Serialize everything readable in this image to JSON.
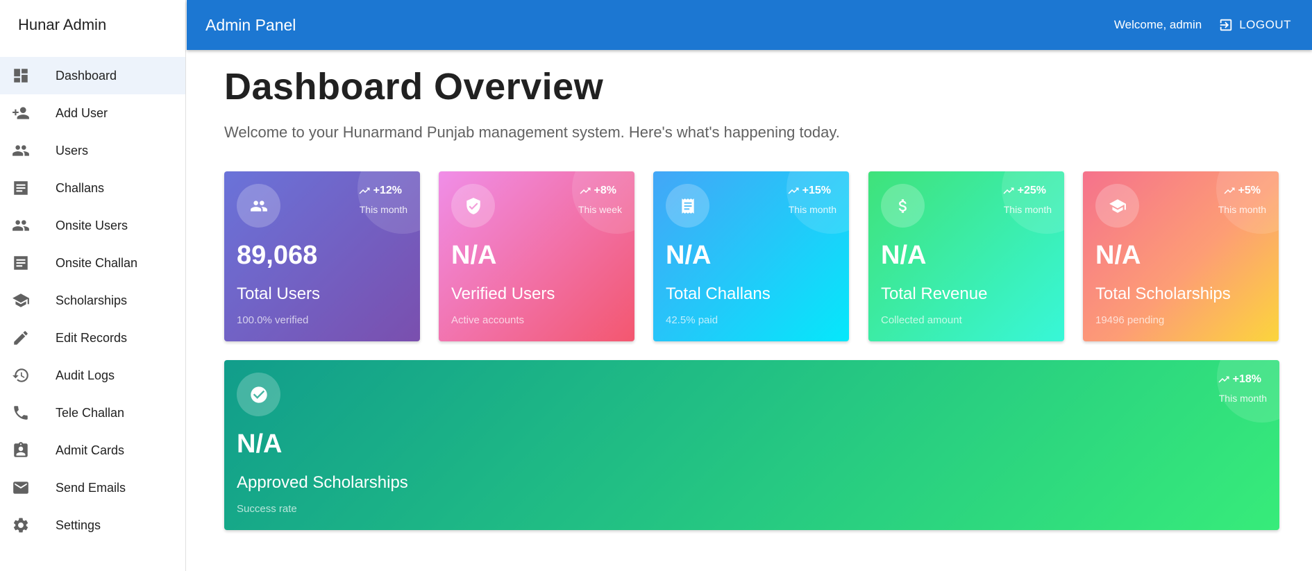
{
  "sidebar": {
    "brand": "Hunar Admin",
    "items": [
      {
        "label": "Dashboard",
        "icon": "dashboard-icon"
      },
      {
        "label": "Add User",
        "icon": "person-add-icon"
      },
      {
        "label": "Users",
        "icon": "people-icon"
      },
      {
        "label": "Challans",
        "icon": "receipt-icon"
      },
      {
        "label": "Onsite Users",
        "icon": "people-icon"
      },
      {
        "label": "Onsite Challan",
        "icon": "receipt-icon"
      },
      {
        "label": "Scholarships",
        "icon": "school-icon"
      },
      {
        "label": "Edit Records",
        "icon": "edit-icon"
      },
      {
        "label": "Audit Logs",
        "icon": "history-icon"
      },
      {
        "label": "Tele Challan",
        "icon": "phone-icon"
      },
      {
        "label": "Admit Cards",
        "icon": "badge-icon"
      },
      {
        "label": "Send Emails",
        "icon": "email-icon"
      },
      {
        "label": "Settings",
        "icon": "gear-icon"
      }
    ]
  },
  "appbar": {
    "title": "Admin Panel",
    "welcome": "Welcome, admin",
    "logout_label": "LOGOUT",
    "color": "#1c77d2"
  },
  "main": {
    "title": "Dashboard Overview",
    "subtitle": "Welcome to your Hunarmand Punjab management system. Here's what's happening today."
  },
  "cards": [
    {
      "value": "89,068",
      "label": "Total Users",
      "sub": "100.0% verified",
      "trend": "+12%",
      "period": "This month",
      "icon": "people-icon"
    },
    {
      "value": "N/A",
      "label": "Verified Users",
      "sub": "Active accounts",
      "trend": "+8%",
      "period": "This week",
      "icon": "verified-shield-icon"
    },
    {
      "value": "N/A",
      "label": "Total Challans",
      "sub": "42.5% paid",
      "trend": "+15%",
      "period": "This month",
      "icon": "receipt-icon"
    },
    {
      "value": "N/A",
      "label": "Total Revenue",
      "sub": "Collected amount",
      "trend": "+25%",
      "period": "This month",
      "icon": "dollar-icon"
    },
    {
      "value": "N/A",
      "label": "Total Scholarships",
      "sub": "19496 pending",
      "trend": "+5%",
      "period": "This month",
      "icon": "school-icon"
    }
  ],
  "wide_card": {
    "value": "N/A",
    "label": "Approved Scholarships",
    "sub": "Success rate",
    "trend": "+18%",
    "period": "This month",
    "icon": "check-circle-icon"
  }
}
